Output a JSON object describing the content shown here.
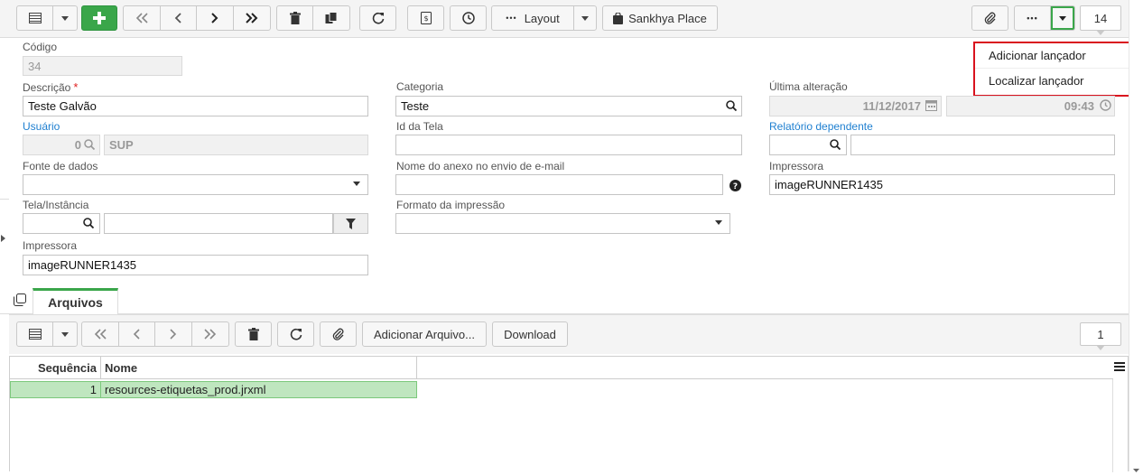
{
  "toolbar": {
    "layout_label": "Layout",
    "place_label": "Sankhya Place",
    "record_count": "14",
    "more_label": "•••"
  },
  "dropdown_menu": {
    "items": [
      {
        "label": "Adicionar lançador"
      },
      {
        "label": "Localizar lançador"
      }
    ]
  },
  "form": {
    "codigo": {
      "label": "Código",
      "value": "34"
    },
    "descricao": {
      "label": "Descrição",
      "required_mark": "*",
      "value": "Teste Galvão"
    },
    "categoria": {
      "label": "Categoria",
      "value": "Teste"
    },
    "ultima_alteracao": {
      "label": "Última alteração",
      "date": "11/12/2017",
      "time": "09:43"
    },
    "usuario": {
      "label": "Usuário",
      "code": "0",
      "name": "SUP"
    },
    "id_tela": {
      "label": "Id da Tela",
      "value": ""
    },
    "relatorio_dependente": {
      "label": "Relatório dependente",
      "code": "",
      "name": ""
    },
    "fonte_dados": {
      "label": "Fonte de dados",
      "value": ""
    },
    "nome_anexo": {
      "label": "Nome do anexo no envio de e-mail",
      "value": ""
    },
    "impressora_right": {
      "label": "Impressora",
      "value": "imageRUNNER1435"
    },
    "tela_instancia": {
      "label": "Tela/Instância",
      "code": "",
      "name": ""
    },
    "formato_impressao": {
      "label": "Formato da impressão",
      "value": ""
    },
    "impressora_left": {
      "label": "Impressora",
      "value": "imageRUNNER1435"
    }
  },
  "tabs": [
    {
      "label": "Arquivos"
    }
  ],
  "subtoolbar": {
    "add_file_label": "Adicionar Arquivo...",
    "download_label": "Download",
    "record_count": "1"
  },
  "grid": {
    "columns": [
      "Sequência",
      "Nome"
    ],
    "rows": [
      {
        "sequencia": "1",
        "nome": "resources-etiquetas_prod.jrxml"
      }
    ]
  },
  "colors": {
    "accent_green": "#3aa64a",
    "link_blue": "#1e7fd0",
    "required_red": "#e02020",
    "highlight_red": "#d9121e"
  }
}
